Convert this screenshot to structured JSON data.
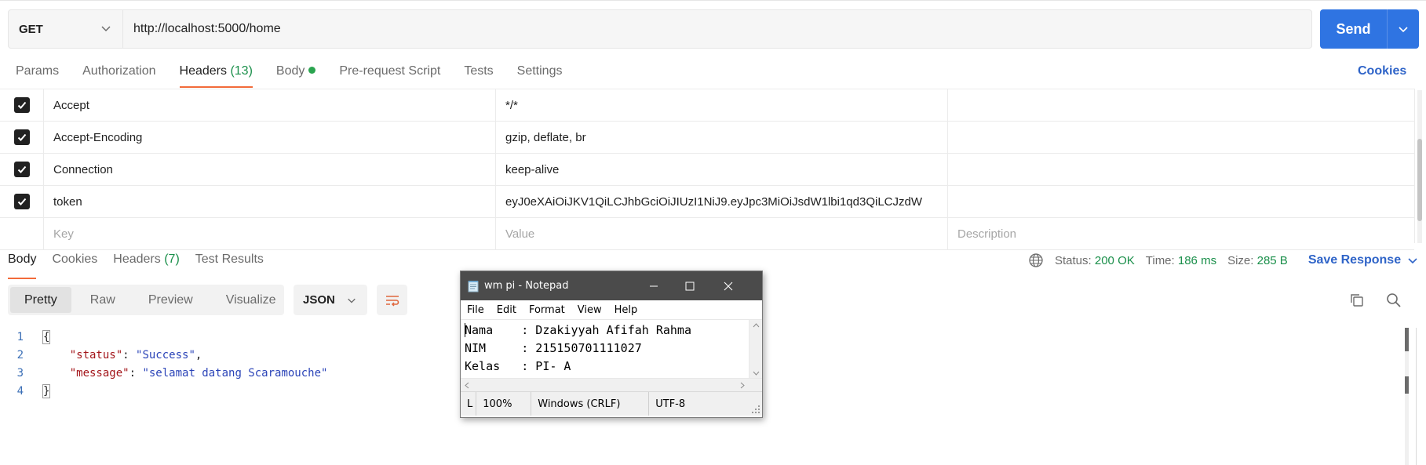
{
  "request": {
    "method": "GET",
    "url": "http://localhost:5000/home",
    "send_label": "Send"
  },
  "request_tabs": {
    "params": "Params",
    "authorization": "Authorization",
    "headers": "Headers",
    "headers_count": "(13)",
    "body": "Body",
    "prerequest": "Pre-request Script",
    "tests": "Tests",
    "settings": "Settings",
    "cookies": "Cookies"
  },
  "headers_table": {
    "rows": [
      {
        "key": "Accept",
        "value": "*/*",
        "checked": true
      },
      {
        "key": "Accept-Encoding",
        "value": "gzip, deflate, br",
        "checked": true
      },
      {
        "key": "Connection",
        "value": "keep-alive",
        "checked": true
      },
      {
        "key": "token",
        "value": "eyJ0eXAiOiJKV1QiLCJhbGciOiJIUzI1NiJ9.eyJpc3MiOiJsdW1lbi1qd3QiLCJzdW",
        "checked": true
      }
    ],
    "placeholder": {
      "key": "Key",
      "value": "Value",
      "description": "Description"
    }
  },
  "response_tabs": {
    "body": "Body",
    "cookies": "Cookies",
    "headers": "Headers",
    "headers_count": "(7)",
    "test_results": "Test Results"
  },
  "response_status": {
    "status_label": "Status:",
    "status_value": "200 OK",
    "time_label": "Time:",
    "time_value": "186 ms",
    "size_label": "Size:",
    "size_value": "285 B",
    "save_response": "Save Response"
  },
  "response_view": {
    "modes": [
      "Pretty",
      "Raw",
      "Preview",
      "Visualize"
    ],
    "active_mode": "Pretty",
    "format": "JSON"
  },
  "response_body": {
    "line_numbers": [
      "1",
      "2",
      "3",
      "4"
    ],
    "open_brace": "{",
    "close_brace": "}",
    "status_key": "\"status\"",
    "status_value": "\"Success\"",
    "message_key": "\"message\"",
    "message_value": "\"selamat datang Scaramouche\""
  },
  "notepad": {
    "title": "wm pi - Notepad",
    "menu": [
      "File",
      "Edit",
      "Format",
      "View",
      "Help"
    ],
    "lines": [
      "Nama    : Dzakiyyah Afifah Rahma",
      "NIM     : 215150701111027",
      "Kelas   : PI- A"
    ],
    "status": {
      "position": "L",
      "zoom": "100%",
      "line_ending": "Windows (CRLF)",
      "encoding": "UTF-8"
    }
  },
  "colors": {
    "accent": "#2f74e2",
    "tab_underline": "#f26b3a",
    "success": "#1a8f4a",
    "link": "#2f64c8",
    "notepad_titlebar": "#4b4b4b"
  }
}
